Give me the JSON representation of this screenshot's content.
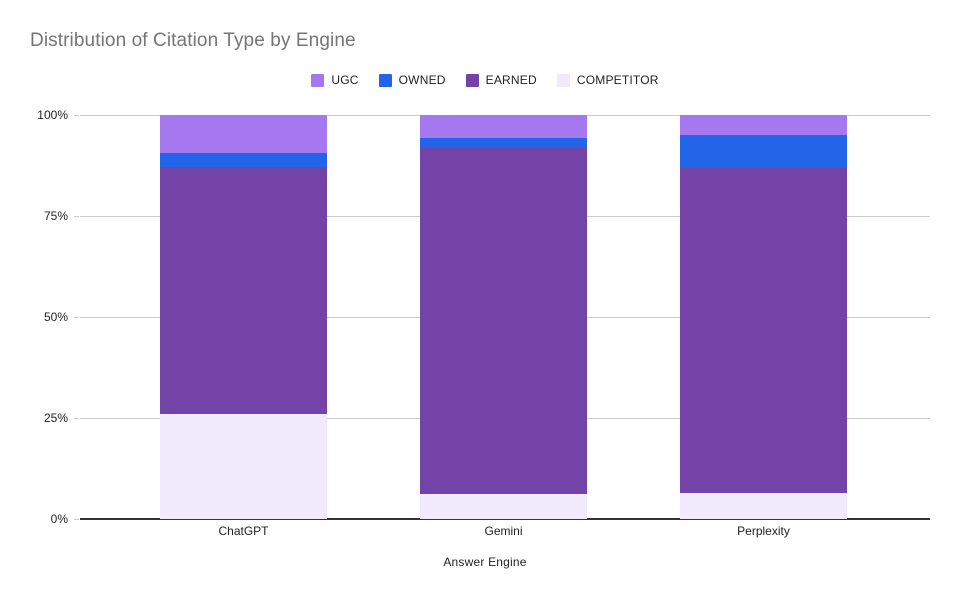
{
  "chart_data": {
    "type": "bar",
    "subtype": "stacked-percent",
    "title": "Distribution of Citation Type by Engine",
    "xlabel": "Answer Engine",
    "ylabel": "",
    "categories": [
      "ChatGPT",
      "Gemini",
      "Perplexity"
    ],
    "ylim": [
      0,
      100
    ],
    "ytick_labels": [
      "0%",
      "25%",
      "50%",
      "75%",
      "100%"
    ],
    "ytick_values": [
      0,
      25,
      50,
      75,
      100
    ],
    "grid": true,
    "legend_position": "top-center",
    "stack_order_bottom_to_top": [
      "COMPETITOR",
      "EARNED",
      "OWNED",
      "UGC"
    ],
    "series": [
      {
        "name": "UGC",
        "color": "#a678f0",
        "values": [
          9.4,
          5.7,
          5.0
        ]
      },
      {
        "name": "OWNED",
        "color": "#2265e8",
        "values": [
          3.5,
          2.5,
          8.2
        ]
      },
      {
        "name": "EARNED",
        "color": "#7443a8",
        "values": [
          61.1,
          85.6,
          80.4
        ]
      },
      {
        "name": "COMPETITOR",
        "color": "#f0eafc",
        "values": [
          26.0,
          6.2,
          6.4
        ]
      }
    ]
  },
  "legend": {
    "items": [
      {
        "label": "UGC",
        "color": "#a678f0"
      },
      {
        "label": "OWNED",
        "color": "#2265e8"
      },
      {
        "label": "EARNED",
        "color": "#7443a8"
      },
      {
        "label": "COMPETITOR",
        "color": "#f0eafc"
      }
    ]
  },
  "axes": {
    "y_ticks": [
      {
        "label": "100%",
        "value": 100
      },
      {
        "label": "75%",
        "value": 75
      },
      {
        "label": "50%",
        "value": 50
      },
      {
        "label": "25%",
        "value": 25
      },
      {
        "label": "0%",
        "value": 0
      }
    ],
    "x_ticks": [
      {
        "label": "ChatGPT"
      },
      {
        "label": "Gemini"
      },
      {
        "label": "Perplexity"
      }
    ],
    "x_title": "Answer Engine"
  },
  "colors": {
    "ugc": "#a678f0",
    "owned": "#2265e8",
    "earned": "#7443a8",
    "competitor": "#f0eafc",
    "grid": "#cccccc",
    "axis": "#333333",
    "title_text": "#757575",
    "label_text": "#222222",
    "background": "#ffffff"
  }
}
